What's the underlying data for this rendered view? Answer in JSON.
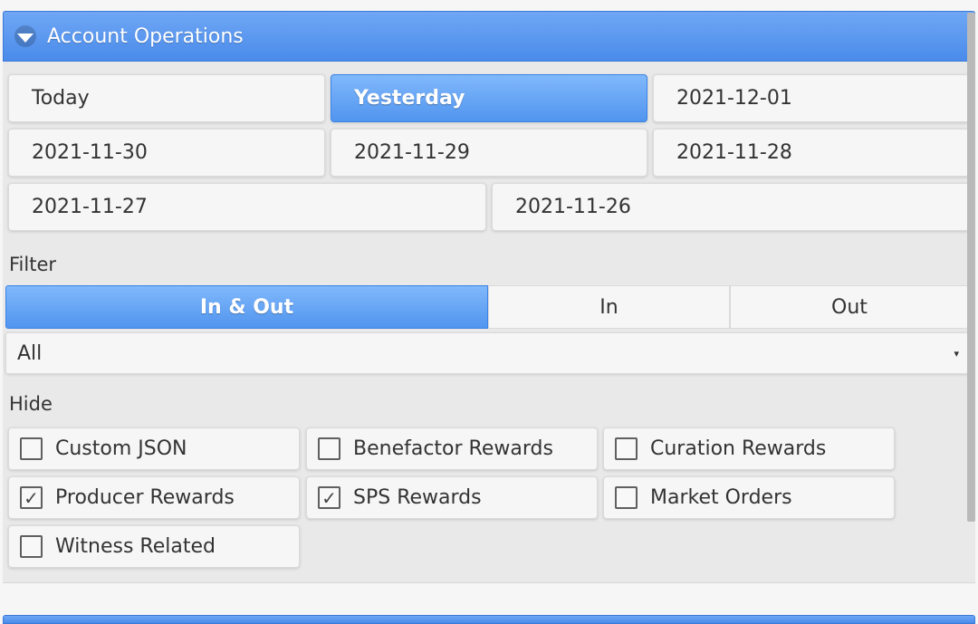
{
  "panel": {
    "title": "Account Operations",
    "collapse_icon": "triangle-down-icon"
  },
  "date_buttons": [
    {
      "label": "Today",
      "active": false
    },
    {
      "label": "Yesterday",
      "active": true
    },
    {
      "label": "2021-12-01",
      "active": false
    },
    {
      "label": "2021-11-30",
      "active": false
    },
    {
      "label": "2021-11-29",
      "active": false
    },
    {
      "label": "2021-11-28",
      "active": false
    },
    {
      "label": "2021-11-27",
      "active": false
    },
    {
      "label": "2021-11-26",
      "active": false
    }
  ],
  "filter": {
    "label": "Filter",
    "segments": [
      {
        "label": "In & Out",
        "active": true
      },
      {
        "label": "In",
        "active": false
      },
      {
        "label": "Out",
        "active": false
      }
    ],
    "select_value": "All",
    "select_caret": "▾"
  },
  "hide": {
    "label": "Hide",
    "options": [
      {
        "label": "Custom JSON",
        "checked": false
      },
      {
        "label": "Benefactor Rewards",
        "checked": false
      },
      {
        "label": "Curation Rewards",
        "checked": false
      },
      {
        "label": "Producer Rewards",
        "checked": true
      },
      {
        "label": "SPS Rewards",
        "checked": true
      },
      {
        "label": "Market Orders",
        "checked": false
      },
      {
        "label": "Witness Related",
        "checked": false
      }
    ],
    "check_mark": "✓"
  },
  "colors": {
    "accent": "#5195ef",
    "header": "#4a8bea",
    "panel_bg": "#e9e9e9"
  }
}
